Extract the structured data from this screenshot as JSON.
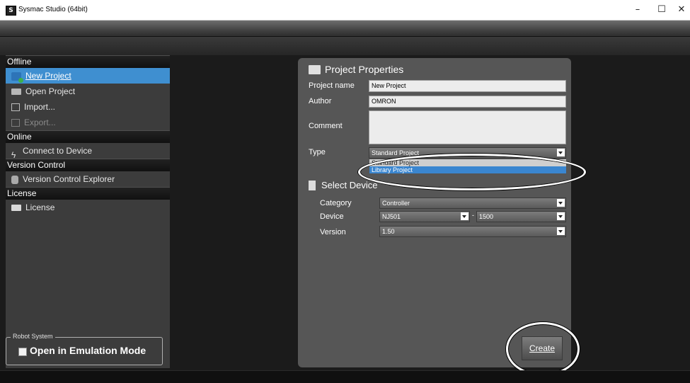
{
  "window": {
    "title": "Sysmac Studio (64bit)",
    "app_icon": "S",
    "minimize": "–",
    "maximize": "☐",
    "close": "✕"
  },
  "sidebar": {
    "sections": [
      {
        "title": "Offline",
        "items": [
          {
            "label": "New Project",
            "icon": "new-project-icon",
            "active": true
          },
          {
            "label": "Open Project",
            "icon": "folder-icon"
          },
          {
            "label": "Import...",
            "icon": "import-icon"
          },
          {
            "label": "Export...",
            "icon": "export-icon",
            "disabled": true
          }
        ]
      },
      {
        "title": "Online",
        "items": [
          {
            "label": "Connect to Device",
            "icon": "bolt-icon"
          }
        ]
      },
      {
        "title": "Version Control",
        "items": [
          {
            "label": "Version Control Explorer",
            "icon": "version-control-icon"
          }
        ]
      },
      {
        "title": "License",
        "items": [
          {
            "label": "License",
            "icon": "license-icon"
          }
        ]
      }
    ],
    "robot": {
      "legend": "Robot System",
      "label": "Open in Emulation Mode",
      "checked": false
    }
  },
  "panel": {
    "title": "Project Properties",
    "project_name_label": "Project name",
    "project_name_value": "New Project",
    "author_label": "Author",
    "author_value": "OMRON",
    "comment_label": "Comment",
    "comment_value": "",
    "type_label": "Type",
    "type_value": "Standard Project",
    "type_options": [
      "Standard Project",
      "Library Project"
    ],
    "type_highlighted": "Library Project",
    "select_device_title": "Select Device",
    "category_label": "Category",
    "category_value": "Controller",
    "device_label": "Device",
    "device_value": "NJ501",
    "device_separator": "-",
    "device_model": "1500",
    "version_label": "Version",
    "version_value": "1.50",
    "create_label": "Create"
  },
  "colors": {
    "accent": "#3f8fd0",
    "background": "#1b1b1b",
    "panel": "#565656",
    "sidebar": "#3c3c3c"
  }
}
